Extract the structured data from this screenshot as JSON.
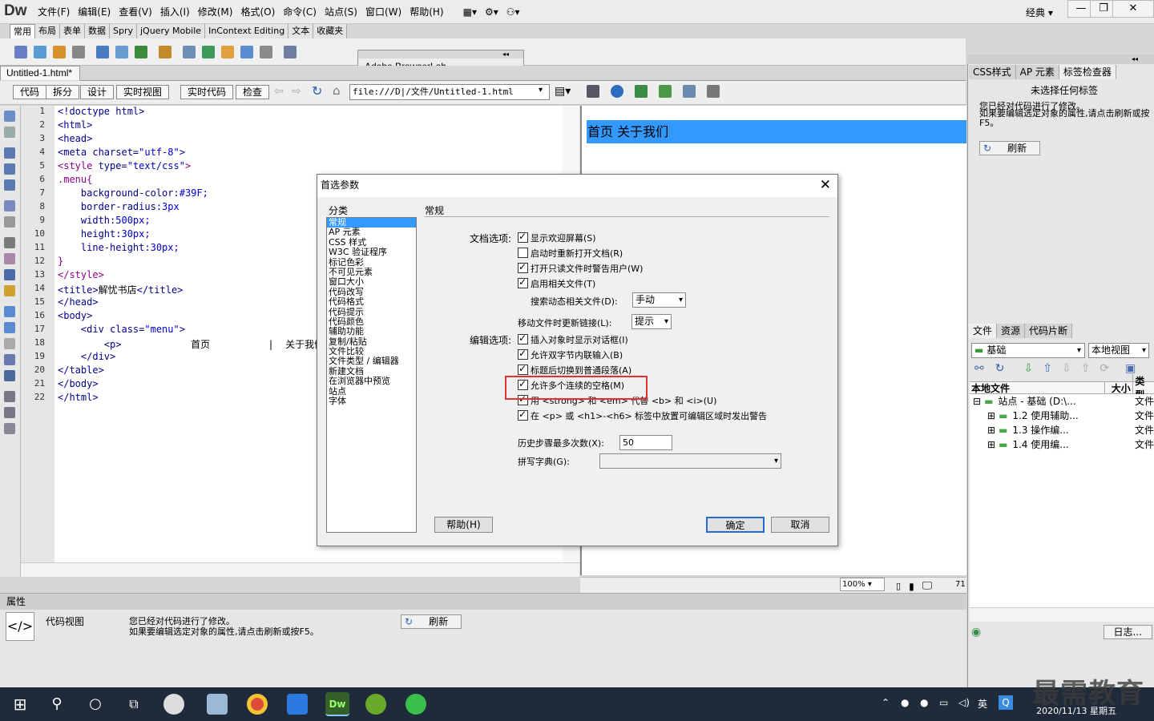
{
  "app": {
    "logo": "Dw",
    "menus": [
      "文件(F)",
      "编辑(E)",
      "查看(V)",
      "插入(I)",
      "修改(M)",
      "格式(O)",
      "命令(C)",
      "站点(S)",
      "窗口(W)",
      "帮助(H)"
    ],
    "workspace": "经典"
  },
  "insert_tabs": [
    "常用",
    "布局",
    "表单",
    "数据",
    "Spry",
    "jQuery Mobile",
    "InContext Editing",
    "文本",
    "收藏夹"
  ],
  "browserlab": "Adobe BrowserLab",
  "doc_tab": "Untitled-1.html*",
  "view_buttons": [
    "代码",
    "拆分",
    "设计",
    "实时视图",
    "实时代码",
    "检查"
  ],
  "address": "file:///D|/文件/Untitled-1.html",
  "code_lines": [
    [
      [
        "tag",
        "<!doctype html>"
      ]
    ],
    [
      [
        "tag",
        "<html>"
      ]
    ],
    [
      [
        "tag",
        "<head>"
      ]
    ],
    [
      [
        "tag",
        "<meta charset="
      ],
      [
        "val",
        "\"utf-8\""
      ],
      [
        "tag",
        ">"
      ]
    ],
    [
      [
        "sty",
        "<style"
      ],
      [
        "tag",
        " type="
      ],
      [
        "val",
        "\"text/css\""
      ],
      [
        "sty",
        ">"
      ]
    ],
    [
      [
        "sty",
        ".menu{"
      ]
    ],
    [
      [
        "prp",
        "    background-color:"
      ],
      [
        "val",
        "#39F;"
      ]
    ],
    [
      [
        "prp",
        "    border-radius:"
      ],
      [
        "val",
        "3px"
      ]
    ],
    [
      [
        "prp",
        "    width:"
      ],
      [
        "val",
        "500px;"
      ]
    ],
    [
      [
        "prp",
        "    height:"
      ],
      [
        "val",
        "30px;"
      ]
    ],
    [
      [
        "prp",
        "    line-height:"
      ],
      [
        "val",
        "30px;"
      ]
    ],
    [
      [
        "sty",
        "}"
      ]
    ],
    [
      [
        "sty",
        "</style>"
      ]
    ],
    [
      [
        "tag",
        "<title>"
      ],
      [
        "txt",
        "解忧书店"
      ],
      [
        "tag",
        "</title>"
      ]
    ],
    [
      [
        "tag",
        "</head>"
      ]
    ],
    [
      [
        "tag",
        "<body>"
      ]
    ],
    [
      [
        "tag",
        "    <div class="
      ],
      [
        "val",
        "\"menu\""
      ],
      [
        "tag",
        ">"
      ]
    ],
    [
      [
        "tag",
        "        <p>"
      ],
      [
        "txt",
        "            首页          |  关于我们"
      ]
    ],
    [
      [
        "tag",
        "    </div>"
      ]
    ],
    [
      [
        "tag",
        "</table>"
      ]
    ],
    [
      [
        "tag",
        "</body>"
      ]
    ],
    [
      [
        "tag",
        "</html>"
      ]
    ]
  ],
  "line_numbers": [
    "1",
    "2",
    "3",
    "4",
    "5",
    "6",
    "7",
    "8",
    "9",
    "10",
    "11",
    "12",
    "13",
    "14",
    "15",
    "16",
    "17",
    "18",
    "19",
    "20",
    "21",
    "22"
  ],
  "design_menu_text": "首页 关于我们",
  "zoom": "100%",
  "status_size": "71",
  "properties": {
    "title": "属性",
    "view_label": "代码视图",
    "msg1": "您已经对代码进行了修改。",
    "msg2": "如果要编辑选定对象的属性,请点击刷新或按F5。",
    "refresh": "刷新"
  },
  "right_panel": {
    "tabs": [
      "CSS样式",
      "AP 元素",
      "标签检查器"
    ],
    "no_tag": "未选择任何标签",
    "msg1": "您已经对代码进行了修改。",
    "msg2": "如果要编辑选定对象的属性,请点击刷新或按F5。",
    "refresh": "刷新",
    "file_tabs": [
      "文件",
      "资源",
      "代码片断"
    ],
    "site": "基础",
    "view": "本地视图",
    "col_local": "本地文件",
    "col_size": "大小",
    "col_type": "类型",
    "files": [
      {
        "name": "站点 - 基础 (D:\\...",
        "type": "文件"
      },
      {
        "name": "1.2 使用辅助...",
        "type": "文件"
      },
      {
        "name": "1.3 操作编...",
        "type": "文件"
      },
      {
        "name": "1.4 使用编...",
        "type": "文件"
      }
    ],
    "log": "日志..."
  },
  "dialog": {
    "title": "首选参数",
    "category_label": "分类",
    "categories": [
      "常规",
      "AP 元素",
      "CSS 样式",
      "W3C 验证程序",
      "标记色彩",
      "不可见元素",
      "窗口大小",
      "代码改写",
      "代码格式",
      "代码提示",
      "代码颜色",
      "辅助功能",
      "复制/粘贴",
      "文件比较",
      "文件类型 / 编辑器",
      "新建文档",
      "在浏览器中预览",
      "站点",
      "字体"
    ],
    "section": "常规",
    "doc_options_label": "文档选项:",
    "doc_options": [
      {
        "label": "显示欢迎屏幕(S)",
        "checked": true
      },
      {
        "label": "启动时重新打开文档(R)",
        "checked": false
      },
      {
        "label": "打开只读文件时警告用户(W)",
        "checked": true
      },
      {
        "label": "启用相关文件(T)",
        "checked": true
      }
    ],
    "dyn_label": "搜索动态相关文件(D):",
    "dyn_value": "手动",
    "move_label": "移动文件时更新链接(L):",
    "move_value": "提示",
    "edit_options_label": "编辑选项:",
    "edit_options": [
      {
        "label": "插入对象时显示对话框(I)",
        "checked": true
      },
      {
        "label": "允许双字节内联输入(B)",
        "checked": true
      },
      {
        "label": "标题后切换到普通段落(A)",
        "checked": true
      },
      {
        "label": "允许多个连续的空格(M)",
        "checked": true
      },
      {
        "label": "用 <strong> 和 <em> 代替 <b> 和 <i>(U)",
        "checked": true
      },
      {
        "label": "在 <p> 或 <h1>-<h6> 标签中放置可编辑区域时发出警告",
        "checked": true
      }
    ],
    "history_label": "历史步骤最多次数(X):",
    "history_value": "50",
    "spell_label": "拼写字典(G):",
    "help_btn": "帮助(H)",
    "ok_btn": "确定",
    "cancel_btn": "取消"
  },
  "taskbar": {
    "time": "2020/11/13 星期五",
    "ime": "英",
    "watermark": "最需教育"
  }
}
